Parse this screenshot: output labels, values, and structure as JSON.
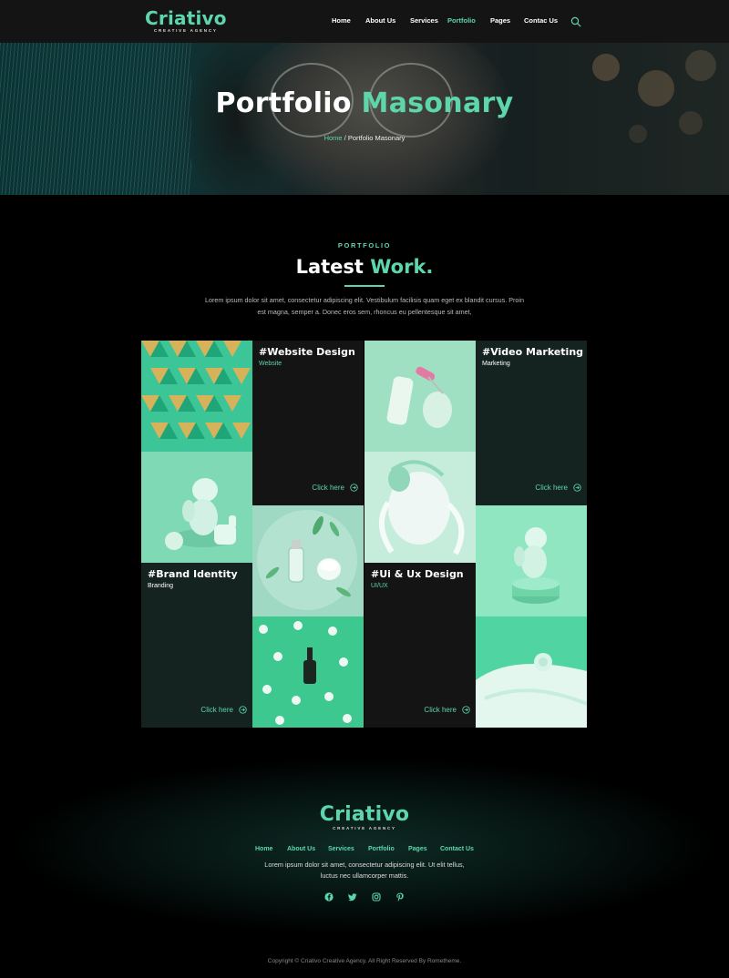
{
  "brand": {
    "name": "Criativo",
    "tagline": "CREATIVE AGENCY"
  },
  "nav": {
    "items": [
      "Home",
      "About Us",
      "Services",
      "Portfolio",
      "Pages",
      "Contac Us"
    ],
    "active": "Portfolio",
    "search_icon": "search-icon"
  },
  "hero": {
    "title_main": "Portfolio",
    "title_accent": "Masonary",
    "breadcrumb_home": "Home",
    "breadcrumb_sep": " / ",
    "breadcrumb_current": "Portfolio Masonary"
  },
  "section": {
    "eyebrow": "PORTFOLIO",
    "title_main": "Latest",
    "title_accent": "Work.",
    "description": "Lorem ipsum dolor sit amet, consectetur adipiscing elit. Vestibulum facilisis quam eget ex blandit cursus. Proin est magna, semper a. Donec eros sem, rhoncus eu pellentesque sit amet,"
  },
  "portfolio": [
    {
      "title": "#Website Design",
      "category": "Website",
      "cta": "Click here"
    },
    {
      "title": "#Video Marketing",
      "category": "Marketing",
      "cta": "Click here"
    },
    {
      "title": "#Brand Identity",
      "category": "Branding",
      "cta": "Click here"
    },
    {
      "title": "#Ui & Ux Design",
      "category": "UI/UX",
      "cta": "Click here"
    }
  ],
  "footer": {
    "menu": [
      "Home",
      "About Us",
      "Services",
      "Portfolio",
      "Pages",
      "Contact Us"
    ],
    "description": "Lorem ipsum dolor sit amet, consectetur adipiscing elit. Ut elit tellus, luctus nec ullamcorper mattis.",
    "social_icons": [
      "facebook-icon",
      "twitter-icon",
      "instagram-icon",
      "pinterest-icon"
    ],
    "copyright": "Copyright © Criativo Creative Agency. All Right Reserved By Rometheme."
  },
  "colors": {
    "accent": "#5ed6ac",
    "card_bg": "#14231f",
    "page_bg": "#000000"
  }
}
